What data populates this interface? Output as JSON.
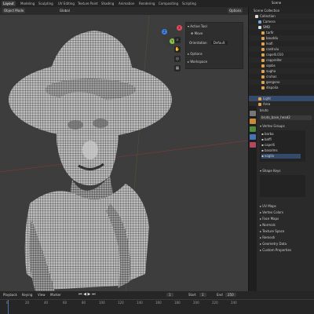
{
  "workspace_tabs": [
    "Layout",
    "Modeling",
    "Sculpting",
    "UV Editing",
    "Texture Paint",
    "Shading",
    "Animation",
    "Rendering",
    "Compositing",
    "Scripting"
  ],
  "scene_label": "Scene",
  "viewport_header": {
    "mode": "Object Mode",
    "view": "View",
    "select": "Select",
    "add": "Add",
    "object": "Object",
    "orientation": "Global",
    "options": "Options"
  },
  "npanel": {
    "active_tool": "Active Tool",
    "tool_name": "Move",
    "orientation_label": "Orientation",
    "orientation_value": "Default",
    "options": "Options",
    "workspace": "Workspace"
  },
  "outliner": {
    "title": "Scene Collection",
    "rows": [
      "Collection",
      "Camera",
      "SMD",
      "tarfir",
      "bauddu",
      "leafi",
      "castrulu",
      "capelli.010",
      "cappreller",
      "sqobs",
      "sugha",
      "cruhas",
      "gongono",
      "dispolia",
      "Light",
      "Area"
    ]
  },
  "properties": {
    "object_name": "bruto",
    "mesh_name": "bruto_base_head2",
    "vertex_groups_label": "Vertex Groups",
    "vertex_groups": [
      "barba",
      "baffi",
      "capelli",
      "basalms",
      "voglia"
    ],
    "shape_keys_label": "Shape Keys",
    "sections": [
      "UV Maps",
      "Vertex Colors",
      "Face Maps",
      "Normals",
      "Texture Space",
      "Remesh",
      "Geometry Data",
      "Custom Properties"
    ]
  },
  "timeline": {
    "playback": "Playback",
    "keying": "Keying",
    "view": "View",
    "marker": "Marker",
    "current_frame": "1",
    "start_label": "Start",
    "start": "1",
    "end_label": "End",
    "end": "250",
    "ticks": [
      "0",
      "20",
      "40",
      "60",
      "80",
      "100",
      "120",
      "140",
      "160",
      "180",
      "200",
      "220",
      "240"
    ]
  },
  "colors": {
    "accent": "#4772b3",
    "background": "#3d3d3d",
    "panel": "#2a2a2a",
    "mesh": "#b8b8b8"
  }
}
